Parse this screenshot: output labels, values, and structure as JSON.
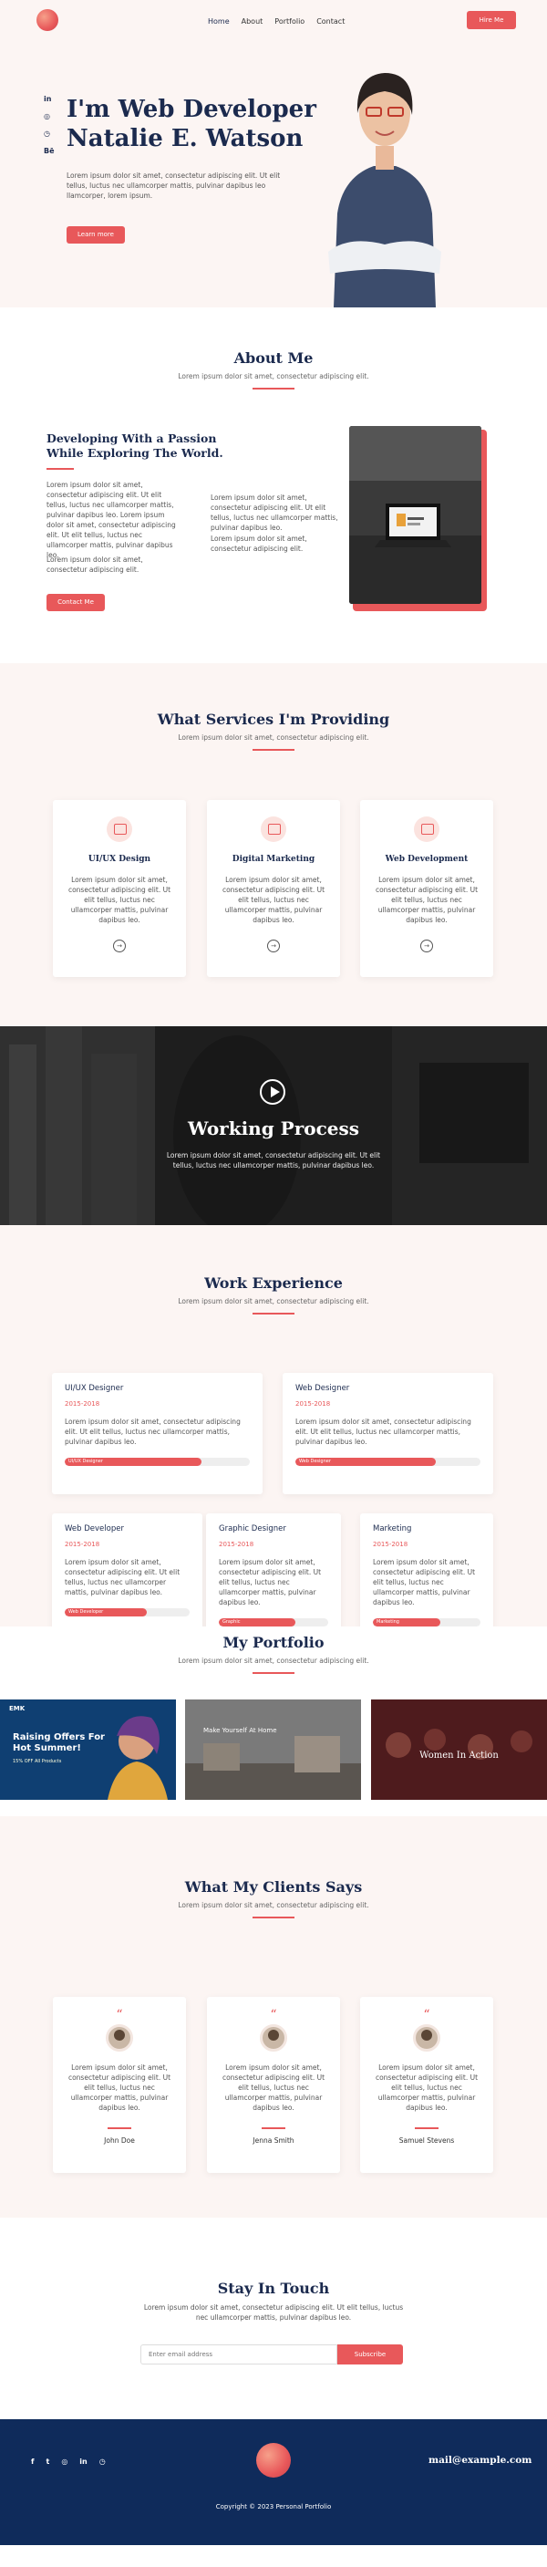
{
  "header": {
    "nav": [
      "Home",
      "About",
      "Portfolio",
      "Contact"
    ],
    "hire_label": "Hire Me"
  },
  "hero": {
    "socials": [
      "in",
      "◎",
      "◷",
      "Bē"
    ],
    "title_line1": "I'm Web Developer",
    "title_line2": "Natalie E. Watson",
    "text": "Lorem ipsum dolor sit amet, consectetur adipiscing elit. Ut elit tellus, luctus nec ullamcorper mattis, pulvinar dapibus leo llamcorper, lorem ipsum.",
    "button_label": "Learn more"
  },
  "about": {
    "title": "About Me",
    "subtitle": "Lorem ipsum dolor sit amet, consectetur adipiscing elit.",
    "heading_line1": "Developing With a Passion",
    "heading_line2": "While Exploring The World.",
    "para_left_1": "Lorem ipsum dolor sit amet, consectetur adipiscing elit. Ut elit tellus, luctus nec ullamcorper mattis, pulvinar dapibus leo. Lorem ipsum dolor sit amet, consectetur adipiscing elit. Ut elit tellus, luctus nec ullamcorper mattis, pulvinar dapibus leo.",
    "para_left_2": "Lorem ipsum dolor sit amet, consectetur adipiscing elit.",
    "para_right_1": "Lorem ipsum dolor sit amet, consectetur adipiscing elit. Ut elit tellus, luctus nec ullamcorper mattis, pulvinar dapibus leo.",
    "para_right_2": "Lorem ipsum dolor sit amet, consectetur adipiscing elit.",
    "button_label": "Contact Me"
  },
  "services": {
    "title": "What Services I'm Providing",
    "subtitle": "Lorem ipsum dolor sit amet, consectetur adipiscing elit.",
    "items": [
      {
        "title": "UI/UX Design",
        "text": "Lorem ipsum dolor sit amet, consectetur adipiscing elit. Ut elit tellus, luctus nec ullamcorper mattis, pulvinar dapibus leo."
      },
      {
        "title": "Digital Marketing",
        "text": "Lorem ipsum dolor sit amet, consectetur adipiscing elit. Ut elit tellus, luctus nec ullamcorper mattis, pulvinar dapibus leo."
      },
      {
        "title": "Web Development",
        "text": "Lorem ipsum dolor sit amet, consectetur adipiscing elit. Ut elit tellus, luctus nec ullamcorper mattis, pulvinar dapibus leo."
      }
    ],
    "arrow": "→"
  },
  "process": {
    "title": "Working Process",
    "text": "Lorem ipsum dolor sit amet, consectetur adipiscing elit. Ut elit tellus, luctus nec ullamcorper mattis, pulvinar dapibus leo."
  },
  "experience": {
    "title": "Work Experience",
    "subtitle": "Lorem ipsum dolor sit amet, consectetur adipiscing elit.",
    "items": [
      {
        "title": "UI/UX Designer",
        "date": "2015-2018",
        "text": "Lorem ipsum dolor sit amet, consectetur adipiscing elit. Ut elit tellus, luctus nec ullamcorper mattis, pulvinar dapibus leo.",
        "bar_label": "UI/UX Designer",
        "level": 0.74
      },
      {
        "title": "Web Designer",
        "date": "2015-2018",
        "text": "Lorem ipsum dolor sit amet, consectetur adipiscing elit. Ut elit tellus, luctus nec ullamcorper mattis, pulvinar dapibus leo.",
        "bar_label": "Web Designer",
        "level": 0.76
      },
      {
        "title": "Web Developer",
        "date": "2015-2018",
        "text": "Lorem ipsum dolor sit amet, consectetur adipiscing elit. Ut elit tellus, luctus nec ullamcorper mattis, pulvinar dapibus leo.",
        "bar_label": "Web Developer",
        "level": 0.66
      },
      {
        "title": "Graphic Designer",
        "date": "2015-2018",
        "text": "Lorem ipsum dolor sit amet, consectetur adipiscing elit. Ut elit tellus, luctus nec ullamcorper mattis, pulvinar dapibus leo.",
        "bar_label": "Graphic",
        "level": 0.7
      },
      {
        "title": "Marketing",
        "date": "2015-2018",
        "text": "Lorem ipsum dolor sit amet, consectetur adipiscing elit. Ut elit tellus, luctus nec ullamcorper mattis, pulvinar dapibus leo.",
        "bar_label": "Marketing",
        "level": 0.63
      }
    ]
  },
  "portfolio": {
    "title": "My Portfolio",
    "subtitle": "Lorem ipsum dolor sit amet, consectetur adipiscing elit.",
    "items": [
      {
        "brand": "EMK",
        "headline_line1": "Raising Offers For",
        "headline_line2": "Hot Summer!",
        "sub": "15% OFF All Products"
      },
      {
        "headline": "Make Yourself At Home"
      },
      {
        "headline": "Women In Action"
      }
    ]
  },
  "testimonials": {
    "title": "What My Clients Says",
    "subtitle": "Lorem ipsum dolor sit amet, consectetur adipiscing elit.",
    "quote_mark": "“",
    "items": [
      {
        "name": "John Doe",
        "text": "Lorem ipsum dolor sit amet, consectetur adipiscing elit. Ut elit tellus, luctus nec ullamcorper mattis, pulvinar dapibus leo."
      },
      {
        "name": "Jenna Smith",
        "text": "Lorem ipsum dolor sit amet, consectetur adipiscing elit. Ut elit tellus, luctus nec ullamcorper mattis, pulvinar dapibus leo."
      },
      {
        "name": "Samuel Stevens",
        "text": "Lorem ipsum dolor sit amet, consectetur adipiscing elit. Ut elit tellus, luctus nec ullamcorper mattis, pulvinar dapibus leo."
      }
    ]
  },
  "subscribe": {
    "title": "Stay In Touch",
    "text": "Lorem ipsum dolor sit amet, consectetur adipiscing elit. Ut elit tellus, luctus nec ullamcorper mattis, pulvinar dapibus leo.",
    "placeholder": "Enter email address",
    "button_label": "Subscribe"
  },
  "footer": {
    "socials": [
      "f",
      "t",
      "◎",
      "in",
      "◷"
    ],
    "email": "mail@example.com",
    "copyright": "Copyright © 2023 Personal Portfolio"
  },
  "colors": {
    "accent": "#e8585a",
    "navy": "#1b2a4e",
    "footer": "#0f2b5b",
    "tint": "#fcf5f3"
  }
}
